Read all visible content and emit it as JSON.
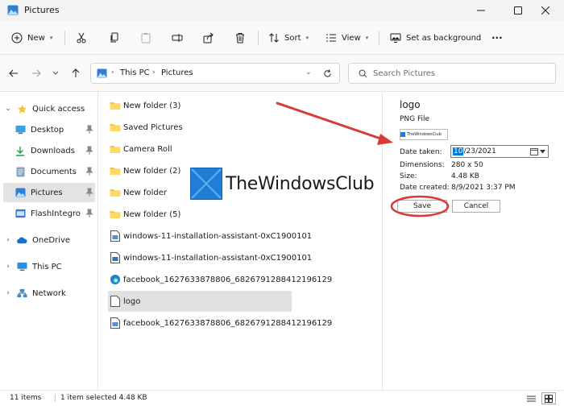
{
  "window": {
    "title": "Pictures"
  },
  "toolbar": {
    "new_label": "New",
    "sort_label": "Sort",
    "view_label": "View",
    "background_label": "Set as background",
    "more_label": "···"
  },
  "address": {
    "breadcrumbs": [
      "This PC",
      "Pictures"
    ],
    "search_placeholder": "Search Pictures"
  },
  "sidebar": {
    "items": [
      {
        "label": "Quick access",
        "icon": "star-icon"
      },
      {
        "label": "Desktop",
        "icon": "desktop-icon"
      },
      {
        "label": "Downloads",
        "icon": "download-icon"
      },
      {
        "label": "Documents",
        "icon": "documents-icon"
      },
      {
        "label": "Pictures",
        "icon": "pictures-icon"
      },
      {
        "label": "FlashIntegro",
        "icon": "app-icon"
      },
      {
        "label": "OneDrive",
        "icon": "cloud-icon"
      },
      {
        "label": "This PC",
        "icon": "computer-icon"
      },
      {
        "label": "Network",
        "icon": "network-icon"
      }
    ]
  },
  "files": [
    {
      "name": "New folder (3)",
      "icon": "folder-icon"
    },
    {
      "name": "Saved Pictures",
      "icon": "folder-icon"
    },
    {
      "name": "Camera Roll",
      "icon": "folder-icon"
    },
    {
      "name": "New folder (2)",
      "icon": "folder-icon"
    },
    {
      "name": "New folder",
      "icon": "folder-icon"
    },
    {
      "name": "New folder (5)",
      "icon": "folder-icon"
    },
    {
      "name": "windows-11-installation-assistant-0xC1900101",
      "icon": "image-file-icon"
    },
    {
      "name": "windows-11-installation-assistant-0xC1900101",
      "icon": "image-file-icon"
    },
    {
      "name": "facebook_1627633878806_6826791288412196129",
      "icon": "edge-file-icon"
    },
    {
      "name": "logo",
      "icon": "blank-file-icon"
    },
    {
      "name": "facebook_1627633878806_6826791288412196129",
      "icon": "image-file-icon"
    }
  ],
  "details": {
    "title": "logo",
    "type": "PNG File",
    "thumbnail_text": "TheWindowsClub",
    "date_taken_label": "Date taken:",
    "date_taken_selected": "10",
    "date_taken_rest": "/23/2021",
    "dimensions_label": "Dimensions:",
    "dimensions_value": "280 x 50",
    "size_label": "Size:",
    "size_value": "4.48 KB",
    "date_created_label": "Date created:",
    "date_created_value": "8/9/2021 3:37 PM",
    "save_label": "Save",
    "cancel_label": "Cancel"
  },
  "status": {
    "count": "11 items",
    "selection": "1 item selected  4.48 KB"
  },
  "watermark": {
    "text": "TheWindowsClub"
  },
  "colors": {
    "accent": "#0078d7",
    "folder": "#f6c445",
    "annotation": "#d9393a",
    "selection": "#e0e0e0"
  }
}
